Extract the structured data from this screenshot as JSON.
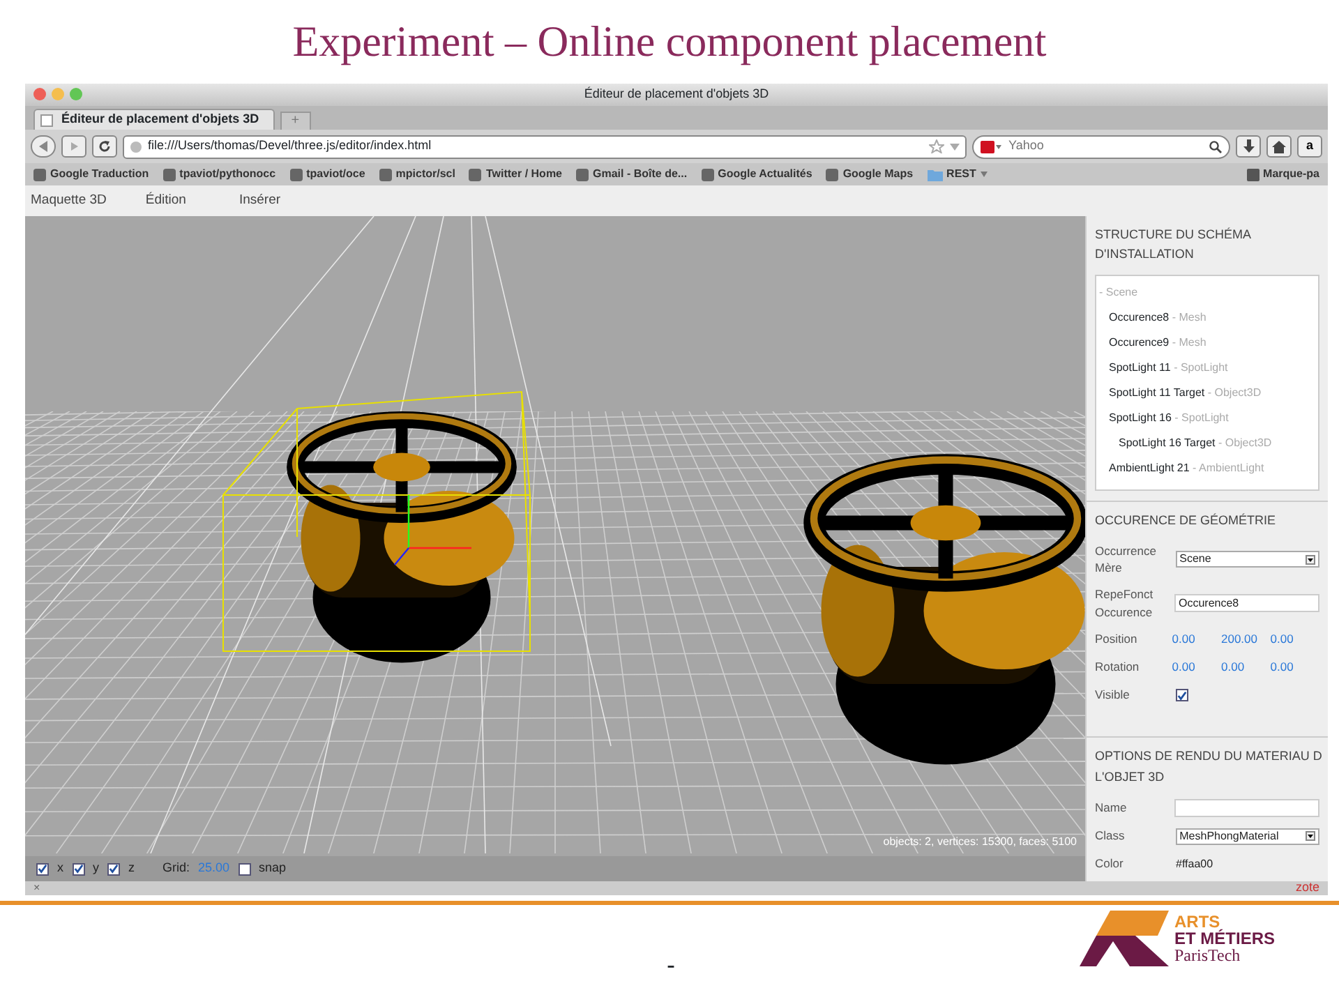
{
  "slide": {
    "title": "Experiment – Online component placement",
    "footer_mark": "-",
    "logo": {
      "line_1": "ARTS",
      "line_2": "ET MÉTIERS",
      "line_3": "ParisTech"
    }
  },
  "window": {
    "title": "Éditeur de placement d'objets 3D"
  },
  "tabs": [
    {
      "label": "Éditeur de placement d'objets 3D",
      "selected": true
    }
  ],
  "new_tab": "+",
  "address_bar": {
    "value": "file:///Users/thomas/Devel/three.js/editor/index.html"
  },
  "search": {
    "placeholder": "Yahoo"
  },
  "amazon_button": "a",
  "bookmarks": [
    {
      "label": "Google Traduction",
      "kind": "site"
    },
    {
      "label": "tpaviot/pythonocc",
      "kind": "site"
    },
    {
      "label": "tpaviot/oce",
      "kind": "site"
    },
    {
      "label": "mpictor/scl",
      "kind": "site"
    },
    {
      "label": "Twitter / Home",
      "kind": "site"
    },
    {
      "label": "Gmail - Boîte de...",
      "kind": "site"
    },
    {
      "label": "Google Actualités",
      "kind": "site"
    },
    {
      "label": "Google Maps",
      "kind": "site"
    },
    {
      "label": "REST",
      "kind": "folder"
    }
  ],
  "bookmarks_menu": "Marque-pa",
  "menu": [
    "Maquette 3D",
    "Édition",
    "Insérer"
  ],
  "viewport": {
    "stats": "objects: 2, vertices: 15300, faces: 5100"
  },
  "toolbar": {
    "axes": [
      {
        "label": "x",
        "checked": true
      },
      {
        "label": "y",
        "checked": true
      },
      {
        "label": "z",
        "checked": true
      }
    ],
    "grid_label": "Grid:",
    "grid_value": "25.00",
    "snap": {
      "label": "snap",
      "checked": false
    }
  },
  "status_bar": {
    "close": "×",
    "text": "zote"
  },
  "scene_panel": {
    "title": "STRUCTURE DU SCHÉMA D'INSTALLATION",
    "tree": [
      {
        "type": "- Scene",
        "children": [
          {
            "name": "Occurence8",
            "type": "- Mesh"
          },
          {
            "name": "Occurence9",
            "type": "- Mesh"
          },
          {
            "name": "SpotLight 11",
            "type": "- SpotLight"
          },
          {
            "name": "SpotLight 11 Target",
            "type": "- Object3D"
          },
          {
            "name": "SpotLight 16",
            "type": "- SpotLight",
            "children": [
              {
                "name": "SpotLight 16 Target",
                "type": "- Object3D"
              }
            ]
          },
          {
            "name": "AmbientLight 21",
            "type": "- AmbientLight"
          }
        ]
      }
    ]
  },
  "geometry_panel": {
    "title": "OCCURENCE DE GÉOMÉTRIE",
    "rows": [
      {
        "kind": "select",
        "label": "Occurrence Mère",
        "value": "Scene"
      },
      {
        "kind": "input",
        "label": "RepeFonct Occurence",
        "value": "Occurence8"
      },
      {
        "kind": "numbers",
        "label": "Position",
        "values": [
          "0.00",
          "200.00",
          "0.00"
        ]
      },
      {
        "kind": "numbers",
        "label": "Rotation",
        "values": [
          "0.00",
          "0.00",
          "0.00"
        ]
      },
      {
        "kind": "checkbox",
        "label": "Visible",
        "checked": true
      }
    ]
  },
  "material_panel": {
    "title_lines": [
      "OPTIONS DE RENDU DU MATERIAU D",
      "L'OBJET 3D"
    ],
    "rows": [
      {
        "kind": "input",
        "label": "Name"
      },
      {
        "kind": "select",
        "label": "Class",
        "value": "MeshPhongMaterial"
      },
      {
        "kind": "text",
        "label": "Color",
        "value": "#ffaa00"
      }
    ]
  }
}
